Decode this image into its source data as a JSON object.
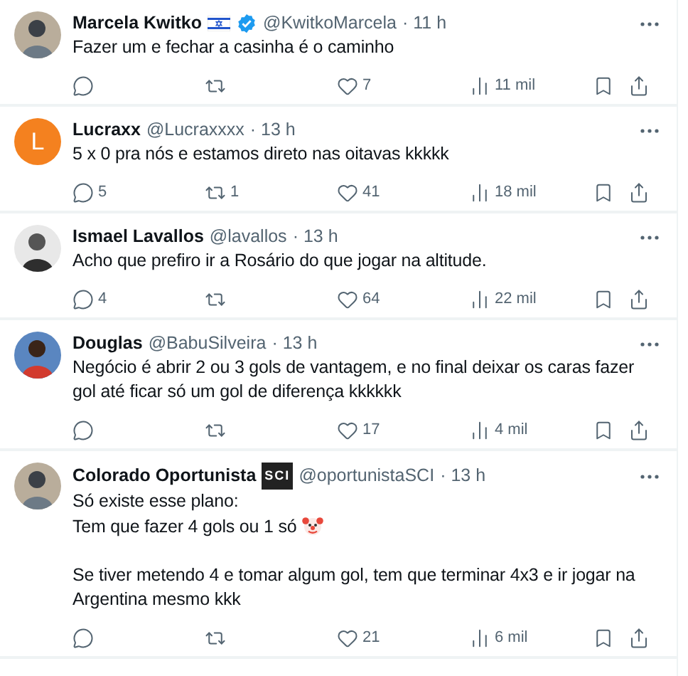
{
  "tweets": [
    {
      "avatar": {
        "kind": "picture"
      },
      "name": "Marcela Kwitko",
      "name_badge": {
        "kind": "flag"
      },
      "verified": true,
      "handle": "@KwitkoMarcela",
      "time": "· 11 h",
      "lines": [
        "Fazer um e fechar a casinha é o caminho"
      ],
      "stats": {
        "likes": "7",
        "views": "11 mil"
      }
    },
    {
      "avatar": {
        "kind": "letter",
        "letter": "L",
        "color": "#f4811f"
      },
      "name": "Lucraxx",
      "verified": false,
      "handle": "@Lucraxxxx",
      "time": "· 13 h",
      "lines": [
        "5 x 0 pra nós e estamos direto nas oitavas kkkkk"
      ],
      "stats": {
        "replies": "5",
        "retweets": "1",
        "likes": "41",
        "views": "18 mil"
      }
    },
    {
      "avatar": {
        "kind": "picture"
      },
      "name": "Ismael Lavallos",
      "verified": false,
      "handle": "@lavallos",
      "time": "· 13 h",
      "lines": [
        "Acho que prefiro ir a Rosário do que jogar na altitude."
      ],
      "stats": {
        "replies": "4",
        "likes": "64",
        "views": "22 mil"
      }
    },
    {
      "avatar": {
        "kind": "picture"
      },
      "name": "Douglas",
      "verified": false,
      "handle": "@BabuSilveira",
      "time": "· 13 h",
      "lines": [
        "Negócio é abrir 2 ou 3 gols de vantagem, e no final deixar os caras fazer gol até ficar só um gol de diferença kkkkkk"
      ],
      "stats": {
        "likes": "17",
        "views": "4 mil"
      }
    },
    {
      "avatar": {
        "kind": "picture"
      },
      "name": "Colorado Oportunista",
      "name_badge": {
        "kind": "text",
        "text": "SCI"
      },
      "verified": false,
      "handle": "@oportunistaSCI",
      "time": "· 13 h",
      "lines": [
        {
          "kind": "text",
          "text": "Só existe esse plano:"
        },
        {
          "kind": "text",
          "text": "Tem que fazer 4 gols ou 1 só",
          "clown": true
        },
        {
          "kind": "blank"
        },
        {
          "kind": "text",
          "text": "Se tiver metendo 4 e tomar algum gol, tem que terminar 4x3 e ir jogar na Argentina mesmo kkk"
        }
      ],
      "stats": {
        "likes": "21",
        "views": "6 mil"
      }
    }
  ]
}
